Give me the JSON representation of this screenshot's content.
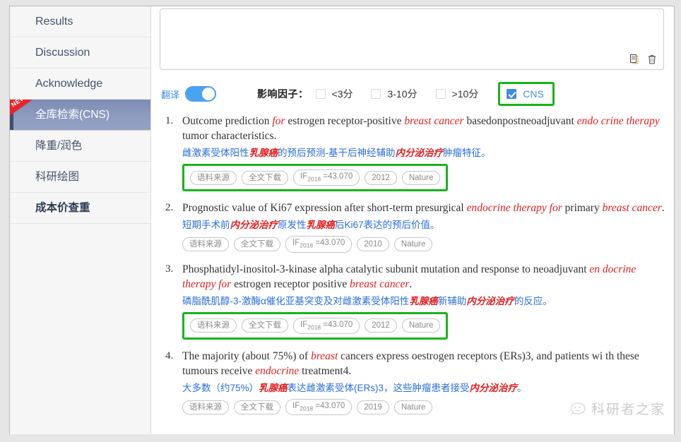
{
  "sidebar": {
    "items": [
      {
        "label": "Results",
        "active": false,
        "badge": null,
        "bold": false,
        "cjk": false
      },
      {
        "label": "Discussion",
        "active": false,
        "badge": null,
        "bold": false,
        "cjk": false
      },
      {
        "label": "Acknowledge",
        "active": false,
        "badge": null,
        "bold": false,
        "cjk": false
      },
      {
        "label": "全库检索(CNS)",
        "active": true,
        "badge": "NEW",
        "bold": false,
        "cjk": true
      },
      {
        "label": "降重/润色",
        "active": false,
        "badge": null,
        "bold": false,
        "cjk": true
      },
      {
        "label": "科研绘图",
        "active": false,
        "badge": null,
        "bold": false,
        "cjk": true
      },
      {
        "label": "成本价查重",
        "active": false,
        "badge": null,
        "bold": true,
        "cjk": true
      }
    ]
  },
  "editor": {
    "value": "",
    "placeholder": "",
    "copy_icon": "copy-icon",
    "delete_icon": "trash-icon"
  },
  "toolbar": {
    "translate_label": "翻译",
    "translate_on": true,
    "impact_factor_label": "影响因子：",
    "filters": [
      {
        "label": "<3分",
        "checked": false,
        "highlighted": false
      },
      {
        "label": "3-10分",
        "checked": false,
        "highlighted": false
      },
      {
        "label": ">10分",
        "checked": false,
        "highlighted": false
      },
      {
        "label": "CNS",
        "checked": true,
        "highlighted": true
      }
    ]
  },
  "results": [
    {
      "number": "1.",
      "title_parts": [
        {
          "t": "Outcome prediction ",
          "em": false
        },
        {
          "t": "for",
          "em": true
        },
        {
          "t": " estrogen receptor-positive ",
          "em": false
        },
        {
          "t": "breast cancer",
          "em": true
        },
        {
          "t": " basedonpostneoadjuvant ",
          "em": false
        },
        {
          "t": "endo crine therapy",
          "em": true
        },
        {
          "t": " tumor characteristics.",
          "em": false
        }
      ],
      "translation_parts": [
        {
          "t": "雌激素受体阳性",
          "em": false
        },
        {
          "t": "乳腺癌",
          "em": true
        },
        {
          "t": "的预后预测-基干后神经辅助",
          "em": false
        },
        {
          "t": "内分泌治疗",
          "em": true
        },
        {
          "t": "肿瘤特征。",
          "em": false
        }
      ],
      "chips": [
        "语料来源",
        "全文下载",
        "IF2018 =43.070",
        "2012",
        "Nature"
      ],
      "chips_highlighted": true
    },
    {
      "number": "2.",
      "title_parts": [
        {
          "t": "Prognostic value of Ki67 expression after short-term presurgical ",
          "em": false
        },
        {
          "t": "endocrine therapy for",
          "em": true
        },
        {
          "t": " primary ",
          "em": false
        },
        {
          "t": "breast cancer",
          "em": true
        },
        {
          "t": ".",
          "em": false
        }
      ],
      "translation_parts": [
        {
          "t": "短期手术前",
          "em": false
        },
        {
          "t": "内分泌治疗",
          "em": true
        },
        {
          "t": "原发性",
          "em": false
        },
        {
          "t": "乳腺癌",
          "em": true
        },
        {
          "t": "后Ki67表达的预后价值。",
          "em": false
        }
      ],
      "chips": [
        "语料来源",
        "全文下载",
        "IF2018 =43.070",
        "2010",
        "Nature"
      ],
      "chips_highlighted": false
    },
    {
      "number": "3.",
      "title_parts": [
        {
          "t": "Phosphatidyl-inositol-3-kinase alpha catalytic subunit mutation and response to neoadjuvant ",
          "em": false
        },
        {
          "t": "en docrine therapy for",
          "em": true
        },
        {
          "t": " estrogen receptor positive ",
          "em": false
        },
        {
          "t": "breast cancer",
          "em": true
        },
        {
          "t": ".",
          "em": false
        }
      ],
      "translation_parts": [
        {
          "t": "磷脂酰肌醇-3-激酶α催化亚基突变及对雌激素受体阳性",
          "em": false
        },
        {
          "t": "乳腺癌",
          "em": true
        },
        {
          "t": "新辅助",
          "em": false
        },
        {
          "t": "内分泌治疗",
          "em": true
        },
        {
          "t": "的反应。",
          "em": false
        }
      ],
      "chips": [
        "语料来源",
        "全文下载",
        "IF2018 =43.070",
        "2012",
        "Nature"
      ],
      "chips_highlighted": true
    },
    {
      "number": "4.",
      "title_parts": [
        {
          "t": "The majority (about 75%) of ",
          "em": false
        },
        {
          "t": "breast",
          "em": true
        },
        {
          "t": " cancers express oestrogen receptors (ERs)3, and patients wi th these tumours receive ",
          "em": false
        },
        {
          "t": "endocrine",
          "em": true
        },
        {
          "t": " treatment4.",
          "em": false
        }
      ],
      "translation_parts": [
        {
          "t": "大多数（约75%）",
          "em": false
        },
        {
          "t": "乳腺癌",
          "em": true
        },
        {
          "t": "表达雌激素受体(ERs)3，这些肿瘤患者接受",
          "em": false
        },
        {
          "t": "内分泌治疗",
          "em": true
        },
        {
          "t": "。",
          "em": false
        }
      ],
      "chips": [
        "语料来源",
        "全文下载",
        "IF2018 =43.070",
        "2019",
        "Nature"
      ],
      "chips_highlighted": false
    }
  ],
  "watermark": {
    "text": "科研者之家",
    "icon": "smiley-face-icon"
  },
  "colors": {
    "accent_blue": "#3b8ae8",
    "highlight_green": "#19b319",
    "keyword_red": "#e02020",
    "translation_blue": "#2b6fd6",
    "active_sidebar": "#8d9cc0",
    "badge_red": "#e8242a"
  }
}
